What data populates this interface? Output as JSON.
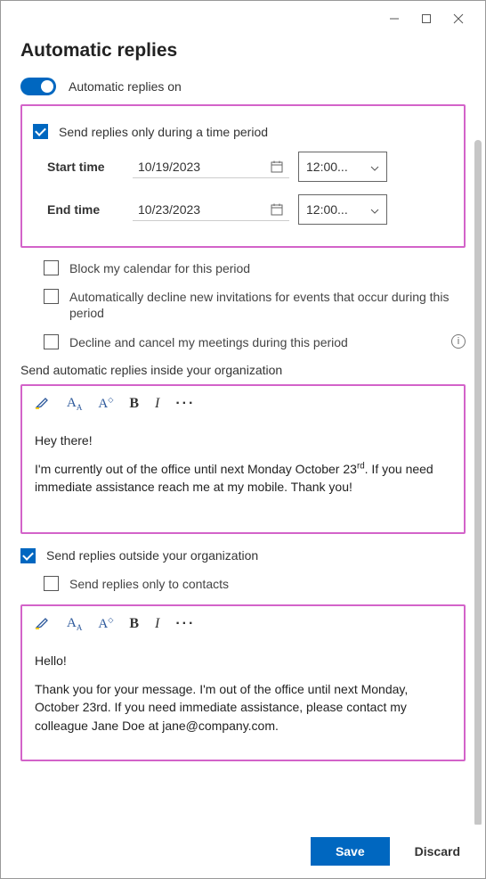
{
  "titlebar": {
    "minimize": "–",
    "maximize": "□",
    "close": "×"
  },
  "header": {
    "title": "Automatic replies"
  },
  "toggle": {
    "label": "Automatic replies on",
    "on": true
  },
  "timeperiod": {
    "checkbox_label": "Send replies only during a time period",
    "start_label": "Start time",
    "start_date": "10/19/2023",
    "start_time": "12:00...",
    "end_label": "End time",
    "end_date": "10/23/2023",
    "end_time": "12:00..."
  },
  "options": {
    "block_calendar": "Block my calendar for this period",
    "decline_new": "Automatically decline new invitations for events that occur during this period",
    "cancel_meetings": "Decline and cancel my meetings during this period"
  },
  "inside": {
    "section_label": "Send automatic replies inside your organization",
    "body_line1": "Hey there!",
    "body_line2_a": "I'm currently out of the office until next Monday October 23",
    "body_line2_sup": "rd",
    "body_line2_b": ". If you need immediate assistance reach me at my mobile. Thank you!"
  },
  "outside": {
    "send_outside_label": "Send replies outside your organization",
    "only_contacts_label": "Send replies only to contacts",
    "body_line1": "Hello!",
    "body_line2": "Thank you for your message. I'm out of the office until next Monday, October 23rd. If you need immediate assistance, please contact my colleague Jane Doe at jane@company.com."
  },
  "footer": {
    "save": "Save",
    "discard": "Discard"
  },
  "icons": {
    "font_color": "A",
    "font_size": "A",
    "bold": "B",
    "italic": "I",
    "more": "···"
  }
}
